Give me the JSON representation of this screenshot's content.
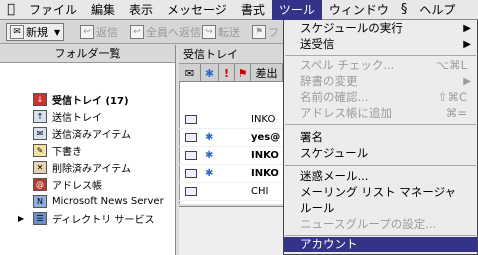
{
  "menubar": {
    "apple": "",
    "items": [
      "ファイル",
      "編集",
      "表示",
      "メッセージ",
      "書式",
      "ツール",
      "ウィンドウ",
      "ヘルプ"
    ],
    "script_icon": "§"
  },
  "toolbar": {
    "new_label": "新規",
    "reply_label": "返信",
    "reply_all_label": "全員へ返信",
    "forward_label": "転送",
    "flag_label": "フ"
  },
  "folders": {
    "header": "フォルダ一覧",
    "items": [
      "受信トレイ (17)",
      "送信トレイ",
      "送信済みアイテム",
      "下書き",
      "削除済みアイテム",
      "アドレス帳",
      "Microsoft News Server",
      "ディレクトリ サービス"
    ]
  },
  "messages": {
    "title": "受信トレイ",
    "column_from": "差出",
    "senders": [
      "INKO",
      "yes@",
      "INKO",
      "INKO",
      "CHI"
    ]
  },
  "tools_menu": {
    "items": [
      {
        "label": "スケジュールの実行",
        "shortcut": "▶"
      },
      {
        "label": "送受信",
        "shortcut": "▶"
      },
      {
        "label": "スペル チェック...",
        "shortcut": "⌥⌘L"
      },
      {
        "label": "辞書の変更",
        "shortcut": "▶"
      },
      {
        "label": "名前の確認...",
        "shortcut": "⇧⌘C"
      },
      {
        "label": "アドレス帳に追加",
        "shortcut": "⌘="
      },
      {
        "label": "署名",
        "shortcut": ""
      },
      {
        "label": "スケジュール",
        "shortcut": ""
      },
      {
        "label": "迷惑メール...",
        "shortcut": ""
      },
      {
        "label": "メーリング リスト マネージャ",
        "shortcut": ""
      },
      {
        "label": "ルール",
        "shortcut": ""
      },
      {
        "label": "ニュースグループの設定...",
        "shortcut": ""
      },
      {
        "label": "アカウント",
        "shortcut": ""
      }
    ]
  }
}
